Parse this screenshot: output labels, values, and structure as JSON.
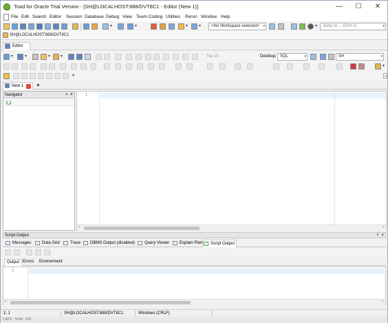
{
  "window": {
    "title": "Toad for Oracle Trial Version - [SH@LOCALHOST:888/DVT8C1 - Editor (New 1)]",
    "controls": {
      "minimize": "—",
      "maximize": "☐",
      "close": "✕"
    }
  },
  "menu": {
    "items": [
      "File",
      "Edit",
      "Search",
      "Editor",
      "Session",
      "Database",
      "Debug",
      "View",
      "Team Coding",
      "Utilities",
      "Rerun",
      "Window",
      "Help"
    ]
  },
  "toolbar": {
    "workspace": "<No Workspace selected>",
    "jump_placeholder": "Jump to....  (Ctrl+J)",
    "top_limit": "Top 20",
    "desktop_label": "Desktop:",
    "desktop_value": "SQL",
    "schema": "SH"
  },
  "connection": {
    "label": "SH@LOCALHOST:888/DVT8C1"
  },
  "editor_tab": {
    "label": "Editor"
  },
  "doc_tabs": {
    "tab_label": "New 1",
    "add_symbol": "+"
  },
  "navigator": {
    "title": "Navigator",
    "pin": "ᵖ",
    "close": "×"
  },
  "editor": {
    "line_number": "1"
  },
  "script_output": {
    "title": "Script Output",
    "tabs": [
      "Messages",
      "Data Grid",
      "Trace",
      "DBMS Output (disabled)",
      "Query Viewer",
      "Explain Plan",
      "Script Output"
    ],
    "active_tab": "Script Output",
    "subtabs": [
      "Output",
      "Errors",
      "Environment"
    ],
    "active_subtab": "Output",
    "line_number": "1"
  },
  "status": {
    "position": "1:  1",
    "connection": "SH@LOCALHOST:888/DVT8C1",
    "line_ending": "Windows (CRLF)",
    "locks": [
      "CAPS",
      "NUM",
      "INS"
    ]
  },
  "colors": {
    "current_line": "#e8f2fc",
    "app_icon": "#6cae33"
  }
}
